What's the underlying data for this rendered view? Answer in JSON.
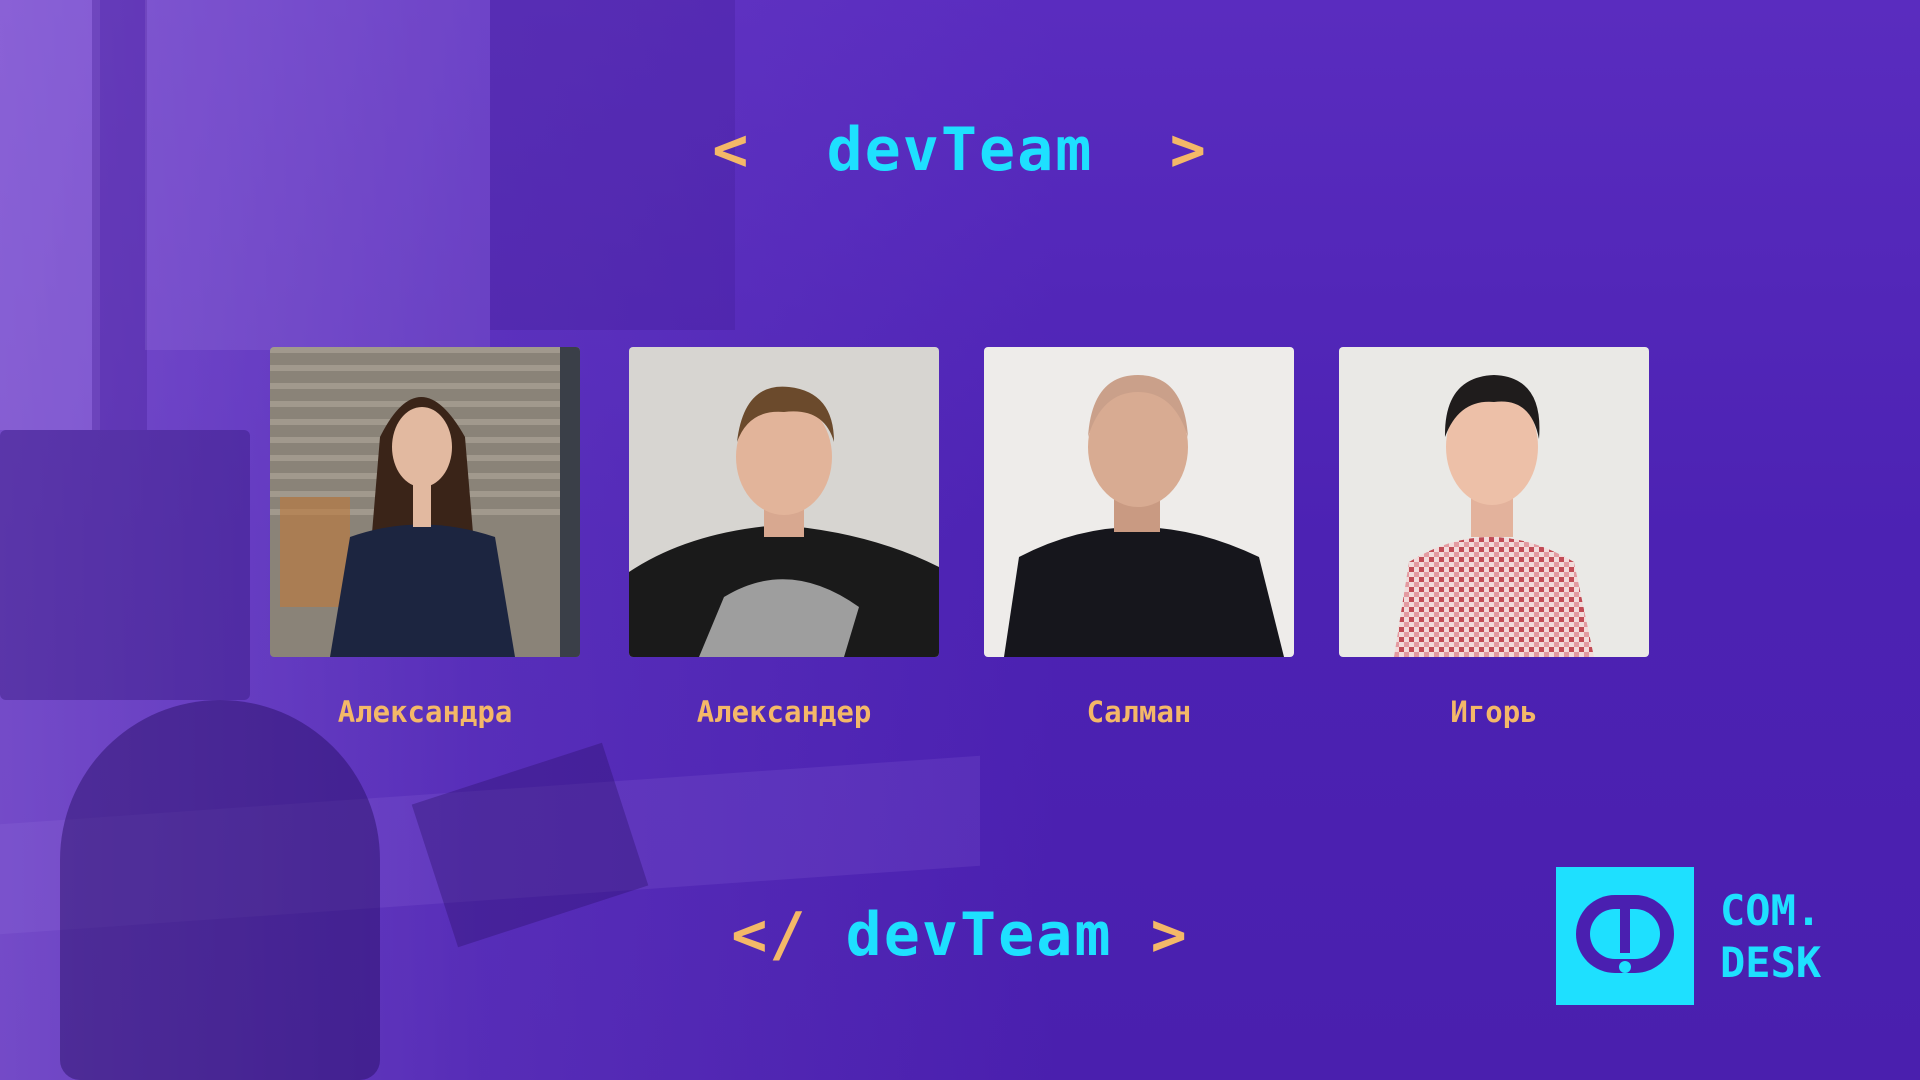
{
  "header": {
    "open_left": "<",
    "title": "devTeam",
    "open_right": ">"
  },
  "footer": {
    "close_left": "</",
    "title": "devTeam",
    "close_right": ">"
  },
  "team": [
    {
      "name": "Александра"
    },
    {
      "name": "Александер"
    },
    {
      "name": "Салман"
    },
    {
      "name": "Игорь"
    }
  ],
  "logo": {
    "line1": "COM.",
    "line2": "DESK"
  },
  "colors": {
    "background": "#4a1fb0",
    "accent_cyan": "#1ee0ff",
    "accent_orange": "#f4b868"
  }
}
